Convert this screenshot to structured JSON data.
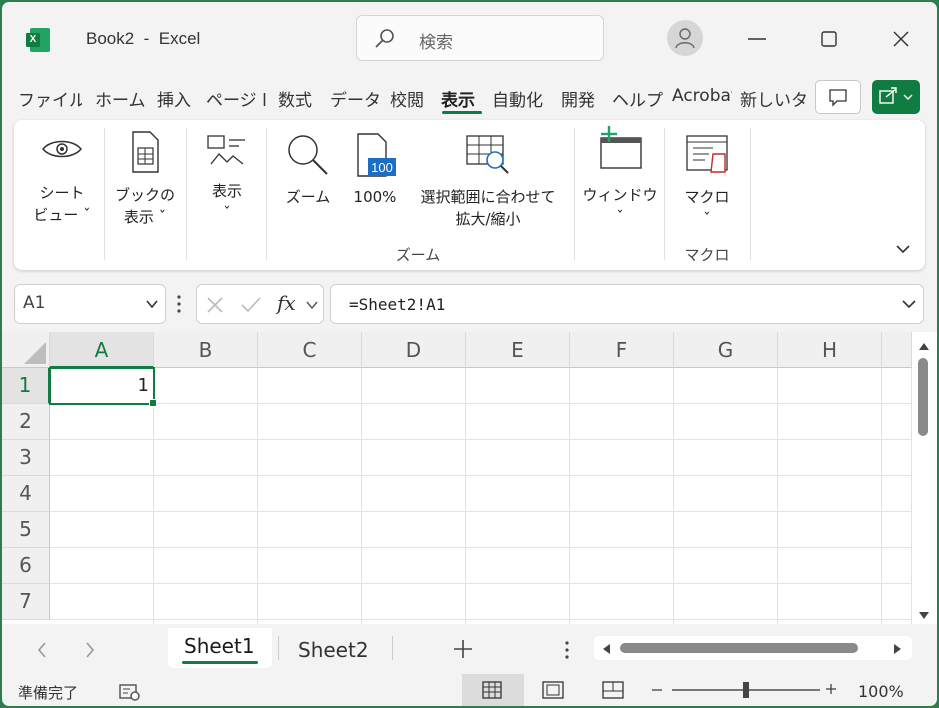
{
  "window": {
    "title": "Book2  -  Excel"
  },
  "search": {
    "placeholder": "検索"
  },
  "ribbon_tabs": [
    "ファイル",
    "ホーム",
    "挿入",
    "ページ l",
    "数式",
    "データ",
    "校閲",
    "表示",
    "自動化",
    "開発",
    "ヘルプ",
    "Acrobat",
    "新しいタ"
  ],
  "active_tab": "表示",
  "ribbon": {
    "sheet_view_line1": "シート",
    "sheet_view_line2": "ビュー ˇ",
    "book_view_line1": "ブックの",
    "book_view_line2": "表示 ˇ",
    "show_label": "表示",
    "zoom_label": "ズーム",
    "zoom100_label": "100%",
    "zoom_selection_line1": "選択範囲に合わせて",
    "zoom_selection_line2": "拡大/縮小",
    "zoom_group": "ズーム",
    "window_label": "ウィンドウ",
    "macro_label": "マクロ",
    "macro_group": "マクロ"
  },
  "formula_bar": {
    "name_box": "A1",
    "fx": "fx",
    "formula": "=Sheet2!A1"
  },
  "grid": {
    "columns": [
      "A",
      "B",
      "C",
      "D",
      "E",
      "F",
      "G",
      "H"
    ],
    "rows": [
      "1",
      "2",
      "3",
      "4",
      "5",
      "6",
      "7"
    ],
    "selected_cell": "A1",
    "a1_value": "1"
  },
  "sheets": [
    "Sheet1",
    "Sheet2"
  ],
  "active_sheet": "Sheet1",
  "status": {
    "ready": "準備完了",
    "zoom": "100%",
    "zoom_fraction": 0.5
  },
  "colors": {
    "accent": "#107c41",
    "frame": "#2e7d4f"
  }
}
